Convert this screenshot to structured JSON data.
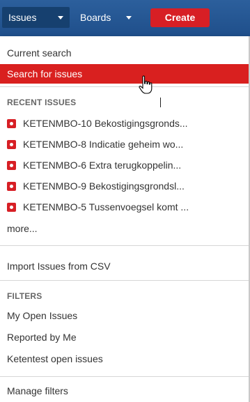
{
  "topnav": {
    "issues_label": "Issues",
    "boards_label": "Boards",
    "create_label": "Create"
  },
  "menu": {
    "current_search": "Current search",
    "search_for_issues": "Search for issues",
    "recent_heading": "RECENT ISSUES",
    "recent_issues": [
      "KETENMBO-10 Bekostigingsgronds...",
      "KETENMBO-8 Indicatie geheim wo...",
      "KETENMBO-6 Extra terugkoppelin...",
      "KETENMBO-9 Bekostigingsgrondsl...",
      "KETENMBO-5 Tussenvoegsel komt ..."
    ],
    "more": "more...",
    "import_csv": "Import Issues from CSV",
    "filters_heading": "FILTERS",
    "filters": [
      "My Open Issues",
      "Reported by Me",
      "Ketentest open issues"
    ],
    "manage_filters": "Manage filters"
  },
  "colors": {
    "nav_bg": "#1f4f8b",
    "accent_red": "#d71f25",
    "selected_bg": "#d9201f"
  },
  "icons": {
    "issue_type": "bug-icon",
    "cursor": "hand-pointer-icon"
  }
}
